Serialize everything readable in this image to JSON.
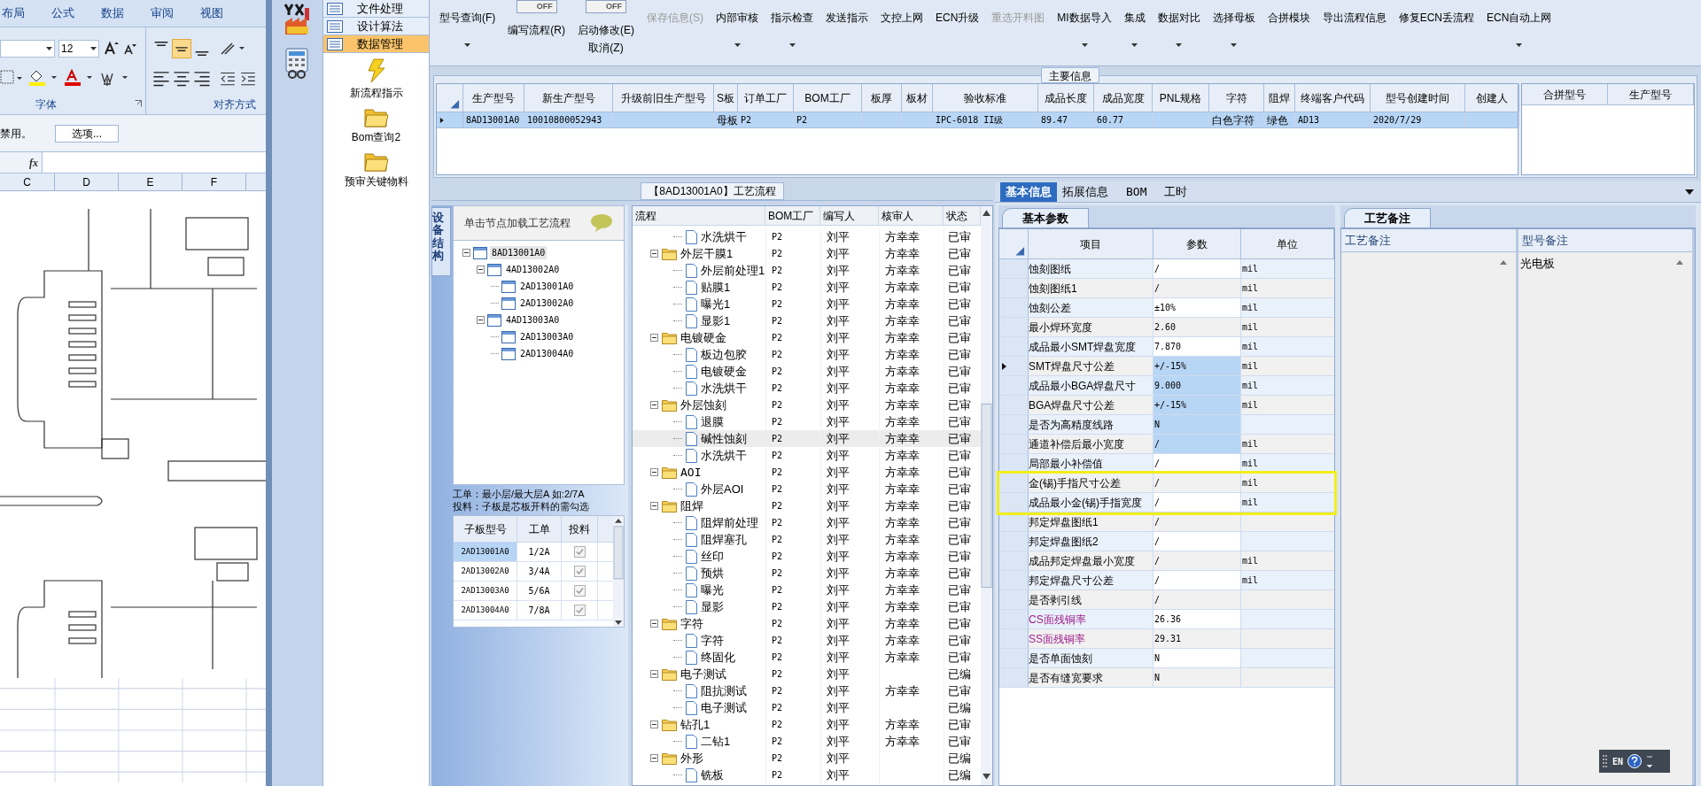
{
  "excel": {
    "tabs": [
      "布局",
      "公式",
      "数据",
      "审阅",
      "视图"
    ],
    "font_size": "12",
    "groups": [
      "字体",
      "对齐方式"
    ],
    "message": "禁用。",
    "options_button": "选项...",
    "formula_label": "fx",
    "columns": [
      "C",
      "D",
      "E",
      "F"
    ],
    "drawing": {
      "kind": "picture"
    }
  },
  "nav": {
    "sections": [
      {
        "label": "文件处理",
        "selected": false
      },
      {
        "label": "设计算法",
        "selected": false
      },
      {
        "label": "数据管理",
        "selected": true
      }
    ],
    "items": [
      {
        "label": "新流程指示",
        "kind": "bolt"
      },
      {
        "label": "Bom查询2",
        "kind": "folder"
      },
      {
        "label": "预审关键物料",
        "kind": "folder"
      }
    ]
  },
  "toolbar": [
    {
      "label": "型号查询(F)",
      "dropdown": true,
      "disabled": false
    },
    {
      "label": "编写流程(R)",
      "toggle": "OFF",
      "on": false,
      "dropdown": false,
      "disabled": false
    },
    {
      "label": "启动修改(E)",
      "sublabel": "取消(Z)",
      "toggle": "OFF",
      "on": false,
      "dropdown": false,
      "disabled": false
    },
    {
      "label": "保存信息(S)",
      "dropdown": false,
      "disabled": true
    },
    {
      "label": "内部审核",
      "dropdown": true,
      "disabled": false
    },
    {
      "label": "指示检查",
      "dropdown": true,
      "disabled": false
    },
    {
      "label": "发送指示",
      "dropdown": false,
      "disabled": false
    },
    {
      "label": "文控上网",
      "dropdown": false,
      "disabled": false
    },
    {
      "label": "ECN升级",
      "dropdown": false,
      "disabled": false
    },
    {
      "label": "重选开料图",
      "dropdown": false,
      "disabled": true
    },
    {
      "label": "MI数据导入",
      "dropdown": true,
      "disabled": false
    },
    {
      "label": "集成",
      "dropdown": true,
      "disabled": false
    },
    {
      "label": "数据对比",
      "dropdown": true,
      "disabled": false
    },
    {
      "label": "选择母板",
      "dropdown": true,
      "disabled": false
    },
    {
      "label": "合拼模块",
      "dropdown": false,
      "disabled": false
    },
    {
      "label": "导出流程信息",
      "dropdown": false,
      "disabled": false
    },
    {
      "label": "修复ECN丢流程",
      "dropdown": false,
      "disabled": false
    },
    {
      "label": "ECN自动上网",
      "dropdown": true,
      "disabled": false
    }
  ],
  "main_info": {
    "title": "主要信息",
    "row_selected": true,
    "columns": [
      {
        "label": "生产型号",
        "value": "8AD13001A0"
      },
      {
        "label": "新生产型号",
        "value": "10010800052943"
      },
      {
        "label": "升级前旧生产型号"
      },
      {
        "label": "S板",
        "value": "母板"
      },
      {
        "label": "订单工厂",
        "value": "P2"
      },
      {
        "label": "BOM工厂",
        "value": "P2"
      },
      {
        "label": "板厚"
      },
      {
        "label": "板材"
      },
      {
        "label": "验收标准",
        "value": "IPC-6018 II级"
      },
      {
        "label": "成品长度",
        "value": "89.47"
      },
      {
        "label": "成品宽度",
        "value": "60.77"
      },
      {
        "label": "PNL规格"
      },
      {
        "label": "字符",
        "value": "白色字符"
      },
      {
        "label": "阻焊",
        "value": "绿色"
      },
      {
        "label": "终端客户代码",
        "value": "AD13"
      },
      {
        "label": "型号创建时间",
        "value": "2020/7/29"
      },
      {
        "label": "创建人"
      }
    ],
    "merge_columns": [
      "合拼型号",
      "生产型号"
    ]
  },
  "process": {
    "title": "【8AD13001A0】工艺流程",
    "side_tab": "设备结构",
    "hint": "单击节点加载工艺流程",
    "tree": [
      {
        "label": "8AD13001A0",
        "expanded": true,
        "selected": true,
        "children": [
          {
            "label": "4AD13002A0",
            "expanded": true,
            "selected": false,
            "children": [
              {
                "label": "2AD13001A0",
                "selected": false
              },
              {
                "label": "2AD13002A0",
                "selected": false
              }
            ]
          },
          {
            "label": "4AD13003A0",
            "expanded": true,
            "selected": false,
            "children": [
              {
                "label": "2AD13003A0",
                "selected": false
              },
              {
                "label": "2AD13004A0",
                "selected": false
              }
            ]
          }
        ]
      }
    ],
    "note": [
      "工单：最小层/最大层A 如:2/7A",
      "投料：子板是芯板开料的需勾选"
    ],
    "sub_boards": {
      "columns": [
        "子板型号",
        "工单",
        "投料"
      ],
      "rows": [
        {
          "model": "2AD13001A0",
          "order": "1/2A",
          "checked": true,
          "selected": true
        },
        {
          "model": "2AD13002A0",
          "order": "3/4A",
          "checked": true,
          "selected": false
        },
        {
          "model": "2AD13003A0",
          "order": "5/6A",
          "checked": true,
          "selected": false
        },
        {
          "model": "2AD13004A0",
          "order": "7/8A",
          "checked": true,
          "selected": false
        }
      ]
    },
    "flow": {
      "columns": [
        "流程",
        "BOM工厂",
        "编写人",
        "核审人",
        "状态"
      ],
      "rows": [
        {
          "children": [
            {
              "name": "水洗烘干",
              "bom": "P2",
              "writer": "刘平",
              "reviewer": "方幸幸",
              "status": "已审",
              "selected": false
            }
          ]
        },
        {
          "name": "外层干膜1",
          "bom": "P2",
          "writer": "刘平",
          "reviewer": "方幸幸",
          "status": "已审",
          "selected": false,
          "expanded": true,
          "children": [
            {
              "name": "外层前处理1",
              "bom": "P2",
              "writer": "刘平",
              "reviewer": "方幸幸",
              "status": "已审",
              "selected": false
            },
            {
              "name": "贴膜1",
              "bom": "P2",
              "writer": "刘平",
              "reviewer": "方幸幸",
              "status": "已审",
              "selected": false
            },
            {
              "name": "曝光1",
              "bom": "P2",
              "writer": "刘平",
              "reviewer": "方幸幸",
              "status": "已审",
              "selected": false
            },
            {
              "name": "显影1",
              "bom": "P2",
              "writer": "刘平",
              "reviewer": "方幸幸",
              "status": "已审",
              "selected": false
            }
          ]
        },
        {
          "name": "电镀硬金",
          "bom": "P2",
          "writer": "刘平",
          "reviewer": "方幸幸",
          "status": "已审",
          "selected": false,
          "expanded": true,
          "children": [
            {
              "name": "板边包胶",
              "bom": "P2",
              "writer": "刘平",
              "reviewer": "方幸幸",
              "status": "已审",
              "selected": false
            },
            {
              "name": "电镀硬金",
              "bom": "P2",
              "writer": "刘平",
              "reviewer": "方幸幸",
              "status": "已审",
              "selected": false
            },
            {
              "name": "水洗烘干",
              "bom": "P2",
              "writer": "刘平",
              "reviewer": "方幸幸",
              "status": "已审",
              "selected": false
            }
          ]
        },
        {
          "name": "外层蚀刻",
          "bom": "P2",
          "writer": "刘平",
          "reviewer": "方幸幸",
          "status": "已审",
          "selected": false,
          "expanded": true,
          "children": [
            {
              "name": "退膜",
              "bom": "P2",
              "writer": "刘平",
              "reviewer": "方幸幸",
              "status": "已审",
              "selected": false
            },
            {
              "name": "碱性蚀刻",
              "bom": "P2",
              "writer": "刘平",
              "reviewer": "方幸幸",
              "status": "已审",
              "selected": true
            },
            {
              "name": "水洗烘干",
              "bom": "P2",
              "writer": "刘平",
              "reviewer": "方幸幸",
              "status": "已审",
              "selected": false
            }
          ]
        },
        {
          "name": "AOI",
          "bom": "P2",
          "writer": "刘平",
          "reviewer": "方幸幸",
          "status": "已审",
          "selected": false,
          "expanded": true,
          "children": [
            {
              "name": "外层AOI",
              "bom": "P2",
              "writer": "刘平",
              "reviewer": "方幸幸",
              "status": "已审",
              "selected": false
            }
          ]
        },
        {
          "name": "阻焊",
          "bom": "P2",
          "writer": "刘平",
          "reviewer": "方幸幸",
          "status": "已审",
          "selected": false,
          "expanded": true,
          "children": [
            {
              "name": "阻焊前处理",
              "bom": "P2",
              "writer": "刘平",
              "reviewer": "方幸幸",
              "status": "已审",
              "selected": false
            },
            {
              "name": "阻焊塞孔",
              "bom": "P2",
              "writer": "刘平",
              "reviewer": "方幸幸",
              "status": "已审",
              "selected": false
            },
            {
              "name": "丝印",
              "bom": "P2",
              "writer": "刘平",
              "reviewer": "方幸幸",
              "status": "已审",
              "selected": false
            },
            {
              "name": "预烘",
              "bom": "P2",
              "writer": "刘平",
              "reviewer": "方幸幸",
              "status": "已审",
              "selected": false
            },
            {
              "name": "曝光",
              "bom": "P2",
              "writer": "刘平",
              "reviewer": "方幸幸",
              "status": "已审",
              "selected": false
            },
            {
              "name": "显影",
              "bom": "P2",
              "writer": "刘平",
              "reviewer": "方幸幸",
              "status": "已审",
              "selected": false
            }
          ]
        },
        {
          "name": "字符",
          "bom": "P2",
          "writer": "刘平",
          "reviewer": "方幸幸",
          "status": "已审",
          "selected": false,
          "expanded": true,
          "children": [
            {
              "name": "字符",
              "bom": "P2",
              "writer": "刘平",
              "reviewer": "方幸幸",
              "status": "已审",
              "selected": false
            },
            {
              "name": "终固化",
              "bom": "P2",
              "writer": "刘平",
              "reviewer": "方幸幸",
              "status": "已审",
              "selected": false
            }
          ]
        },
        {
          "name": "电子测试",
          "bom": "P2",
          "writer": "刘平",
          "status": "已编",
          "selected": false,
          "expanded": true,
          "children": [
            {
              "name": "阻抗测试",
              "bom": "P2",
              "writer": "刘平",
              "reviewer": "方幸幸",
              "status": "已审",
              "selected": false
            },
            {
              "name": "电子测试",
              "bom": "P2",
              "writer": "刘平",
              "status": "已编",
              "selected": false
            }
          ]
        },
        {
          "name": "钻孔1",
          "bom": "P2",
          "writer": "刘平",
          "reviewer": "方幸幸",
          "status": "已审",
          "selected": false,
          "expanded": true,
          "children": [
            {
              "name": "二钻1",
              "bom": "P2",
              "writer": "刘平",
              "reviewer": "方幸幸",
              "status": "已审",
              "selected": false
            }
          ]
        },
        {
          "name": "外形",
          "bom": "P2",
          "writer": "刘平",
          "status": "已编",
          "selected": false,
          "expanded": true,
          "children": [
            {
              "name": "铣板",
              "bom": "P2",
              "writer": "刘平",
              "status": "已编",
              "selected": false
            }
          ]
        }
      ]
    }
  },
  "details": {
    "tabs": [
      {
        "label": "基本信息",
        "selected": true
      },
      {
        "label": "拓展信息",
        "selected": false
      },
      {
        "label": "BOM",
        "selected": false
      },
      {
        "label": "工时",
        "selected": false
      }
    ],
    "params": {
      "tab": "基本参数",
      "columns": [
        "项目",
        "参数",
        "单位"
      ],
      "rows": [
        {
          "item": "蚀刻图纸",
          "value": "/",
          "unit": "mil",
          "selected": false,
          "current": false,
          "boxed": false
        },
        {
          "item": "蚀刻图纸1",
          "value": "/",
          "unit": "mil",
          "selected": false,
          "current": false,
          "boxed": false
        },
        {
          "item": "蚀刻公差",
          "value": "±10%",
          "unit": "mil",
          "selected": false,
          "current": false,
          "boxed": false
        },
        {
          "item": "最小焊环宽度",
          "value": "2.60",
          "unit": "mil",
          "selected": false,
          "current": false,
          "boxed": false
        },
        {
          "item": "成品最小SMT焊盘宽度",
          "value": "7.870",
          "unit": "mil",
          "selected": false,
          "current": false,
          "boxed": false
        },
        {
          "item": "SMT焊盘尺寸公差",
          "value": "+/-15%",
          "unit": "mil",
          "selected": true,
          "current": true,
          "boxed": false
        },
        {
          "item": "成品最小BGA焊盘尺寸",
          "value": "9.000",
          "unit": "mil",
          "selected": true,
          "current": false,
          "boxed": false
        },
        {
          "item": "BGA焊盘尺寸公差",
          "value": "+/-15%",
          "unit": "mil",
          "selected": true,
          "current": false,
          "boxed": false
        },
        {
          "item": "是否为高精度线路",
          "value": "N",
          "selected": true,
          "current": false,
          "boxed": false
        },
        {
          "item": "通道补偿后最小宽度",
          "value": "/",
          "unit": "mil",
          "selected": true,
          "current": false,
          "boxed": false
        },
        {
          "item": "局部最小补偿值",
          "value": "/",
          "unit": "mil",
          "selected": false,
          "current": false,
          "boxed": false
        },
        {
          "item": "金(锡)手指尺寸公差",
          "value": "/",
          "unit": "mil",
          "selected": false,
          "current": false,
          "boxed": true
        },
        {
          "item": "成品最小金(锡)手指宽度",
          "value": "/",
          "unit": "mil",
          "selected": false,
          "current": false,
          "boxed": true
        },
        {
          "item": "邦定焊盘图纸1",
          "value": "/",
          "selected": false,
          "current": false,
          "boxed": false
        },
        {
          "item": "邦定焊盘图纸2",
          "value": "/",
          "selected": false,
          "current": false,
          "boxed": false
        },
        {
          "item": "成品邦定焊盘最小宽度",
          "value": "/",
          "unit": "mil",
          "selected": false,
          "current": false,
          "boxed": false
        },
        {
          "item": "邦定焊盘尺寸公差",
          "value": "/",
          "unit": "mil",
          "selected": false,
          "current": false,
          "boxed": false
        },
        {
          "item": "是否剥引线",
          "value": "/",
          "selected": false,
          "current": false,
          "boxed": false
        },
        {
          "item": "CS面残铜率",
          "value": "26.36",
          "color": "#a0208c",
          "selected": false,
          "current": false,
          "boxed": false
        },
        {
          "item": "SS面残铜率",
          "value": "29.31",
          "color": "#a0208c",
          "selected": false,
          "current": false,
          "boxed": false
        },
        {
          "item": "是否单面蚀刻",
          "value": "N",
          "selected": false,
          "current": false,
          "boxed": false
        },
        {
          "item": "是否有缝宽要求",
          "value": "N",
          "selected": false,
          "current": false,
          "boxed": false
        }
      ]
    },
    "remarks": {
      "tab": "工艺备注",
      "columns": [
        "工艺备注",
        "型号备注"
      ],
      "model_remark": "光电板"
    }
  },
  "lang_bar": {
    "label": "EN"
  }
}
